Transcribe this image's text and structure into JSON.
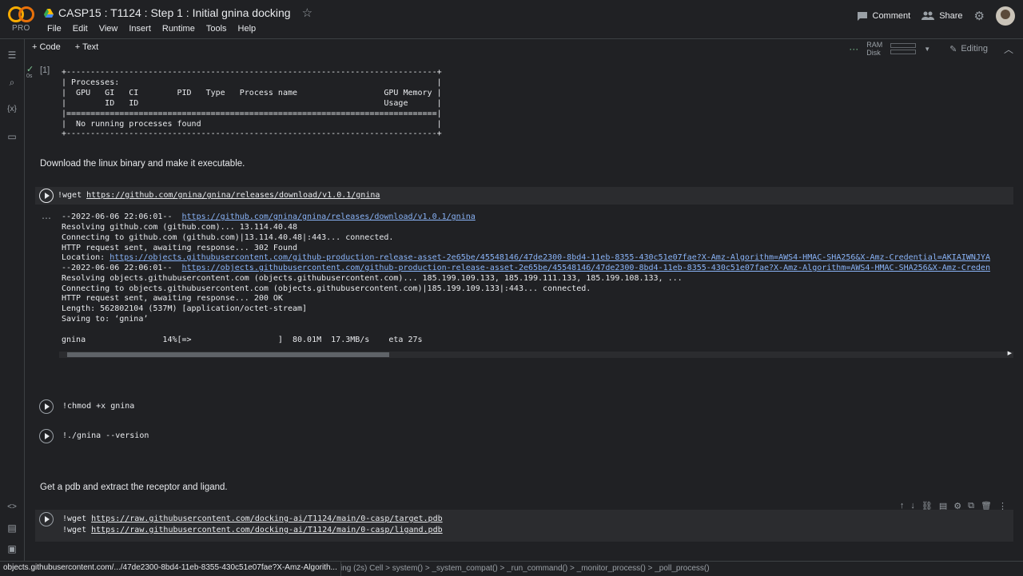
{
  "header": {
    "brand": "PRO",
    "title": "CASP15 : T1124 : Step 1 : Initial gnina docking",
    "comment_label": "Comment",
    "share_label": "Share"
  },
  "menu": [
    "File",
    "Edit",
    "View",
    "Insert",
    "Runtime",
    "Tools",
    "Help"
  ],
  "toolbar": {
    "code_label": "+ Code",
    "text_label": "+ Text",
    "ram_label": "RAM",
    "disk_label": "Disk",
    "editing_label": "Editing"
  },
  "cells": {
    "cell1": {
      "exec_count": "[1]",
      "exec_time": "0s",
      "output": "+-----------------------------------------------------------------------------+\n| Processes:                                                                  |\n|  GPU   GI   CI        PID   Type   Process name                  GPU Memory |\n|        ID   ID                                                   Usage      |\n|=============================================================================|\n|  No running processes found                                                 |\n+-----------------------------------------------------------------------------+"
    },
    "text1": "Download the linux binary and make it executable.",
    "wget_gnina": {
      "cmd": "!wget ",
      "url": "https://github.com/gnina/gnina/releases/download/v1.0.1/gnina",
      "output": {
        "line1_prefix": "--2022-06-06 22:06:01--  ",
        "line1_url": "https://github.com/gnina/gnina/releases/download/v1.0.1/gnina",
        "line2": "Resolving github.com (github.com)... 13.114.40.48",
        "line3": "Connecting to github.com (github.com)|13.114.40.48|:443... connected.",
        "line4": "HTTP request sent, awaiting response... 302 Found",
        "line5_prefix": "Location: ",
        "line5_url": "https://objects.githubusercontent.com/github-production-release-asset-2e65be/45548146/47de2300-8bd4-11eb-8355-430c51e07fae?X-Amz-Algorithm=AWS4-HMAC-SHA256&X-Amz-Credential=AKIAIWNJYA",
        "line6_prefix": "--2022-06-06 22:06:01--  ",
        "line6_url": "https://objects.githubusercontent.com/github-production-release-asset-2e65be/45548146/47de2300-8bd4-11eb-8355-430c51e07fae?X-Amz-Algorithm=AWS4-HMAC-SHA256&X-Amz-Creden",
        "line7": "Resolving objects.githubusercontent.com (objects.githubusercontent.com)... 185.199.109.133, 185.199.111.133, 185.199.108.133, ...",
        "line8": "Connecting to objects.githubusercontent.com (objects.githubusercontent.com)|185.199.109.133|:443... connected.",
        "line9": "HTTP request sent, awaiting response... 200 OK",
        "line10": "Length: 562802104 (537M) [application/octet-stream]",
        "line11": "Saving to: ‘gnina’",
        "progress": "gnina                14%[=>                  ]  80.01M  17.3MB/s    eta 27s"
      }
    },
    "chmod": "!chmod +x gnina",
    "version": "!./gnina --version",
    "text2": "Get a pdb and extract the receptor and ligand.",
    "wget_pdb": {
      "cmd1": "!wget ",
      "url1": "https://raw.githubusercontent.com/docking-ai/T1124/main/0-casp/target.pdb",
      "cmd2": "!wget ",
      "url2": "https://raw.githubusercontent.com/docking-ai/T1124/main/0-casp/ligand.pdb"
    }
  },
  "statusbar": {
    "hover_url": "objects.githubusercontent.com/.../47de2300-8bd4-11eb-8355-430c51e07fae?X-Amz-Algorith...",
    "trace": "ing (2s)  Cell > system() > _system_compat() > _run_command() > _monitor_process() > _poll_process()"
  },
  "colors": {
    "background": "#202124",
    "link": "#8ab4f8",
    "cell_bg": "#2b2c2f",
    "logo_yellow": "#f9ab00",
    "logo_orange": "#e8710a"
  }
}
